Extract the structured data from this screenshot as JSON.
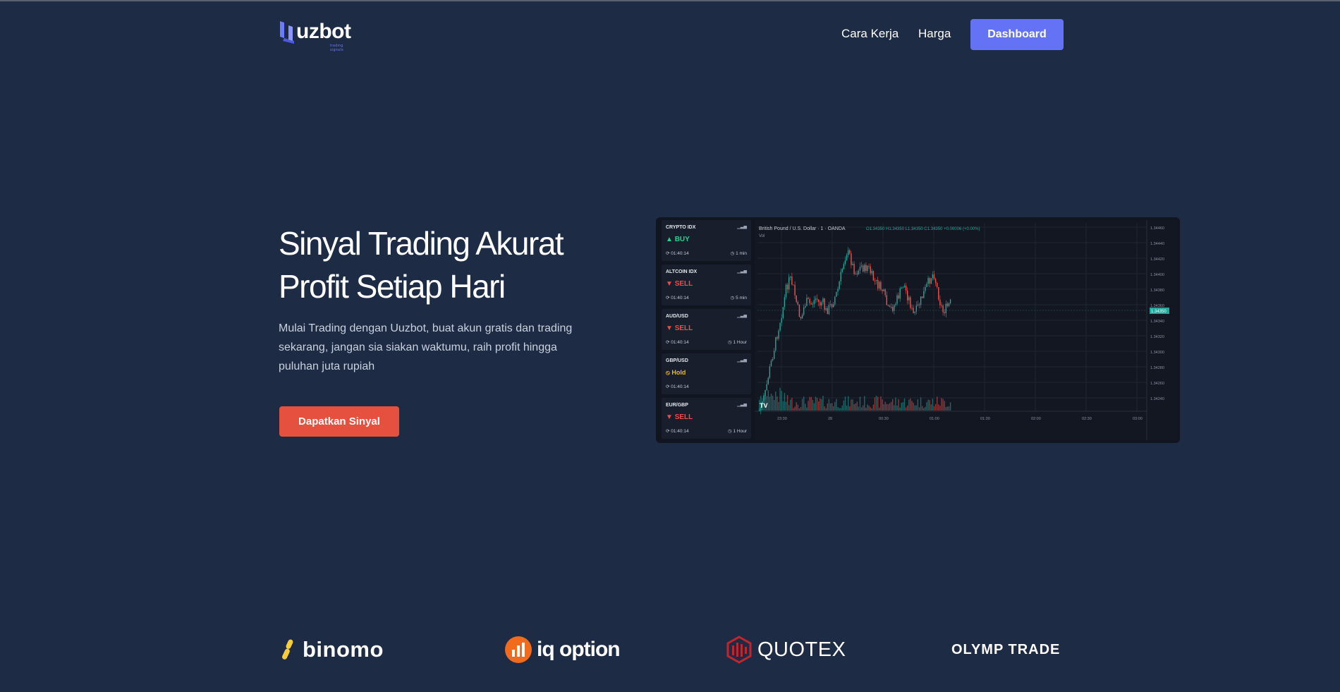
{
  "nav": {
    "logo_text": "uzbot",
    "logo_tagline": "trading signals",
    "links": [
      "Cara Kerja",
      "Harga"
    ],
    "dashboard_label": "Dashboard"
  },
  "hero": {
    "title_line1": "Sinyal Trading Akurat",
    "title_line2": "Profit Setiap Hari",
    "description": "Mulai Trading dengan Uuzbot, buat akun gratis dan trading sekarang, jangan sia siakan waktumu, raih profit hingga puluhan juta rupiah",
    "cta_label": "Dapatkan Sinyal"
  },
  "preview": {
    "signals": [
      {
        "pair": "CRYPTO IDX",
        "action": "BUY",
        "type": "buy",
        "time": "01:40:14",
        "timeframe": "1 min"
      },
      {
        "pair": "ALTCOIN IDX",
        "action": "SELL",
        "type": "sell",
        "time": "01:40:14",
        "timeframe": "5 min"
      },
      {
        "pair": "AUD/USD",
        "action": "SELL",
        "type": "sell",
        "time": "01:40:14",
        "timeframe": "1 Hour"
      },
      {
        "pair": "GBP/USD",
        "action": "Hold",
        "type": "hold",
        "time": "01:40:14",
        "timeframe": ""
      },
      {
        "pair": "EUR/GBP",
        "action": "SELL",
        "type": "sell",
        "time": "01:40:14",
        "timeframe": "1 Hour"
      }
    ],
    "chart_title": "British Pound / U.S. Dollar · 1 · OANDA",
    "chart_ohlc": "O1.34350 H1.34350 L1.34350 C1.34350 +0.00006 (+0.00%)",
    "chart_vol": "Vol",
    "x_ticks": [
      "23:30",
      "28",
      "00:30",
      "01:00",
      "01:30",
      "02:00",
      "02:30",
      "03:00"
    ],
    "y_ticks": [
      "1.34460",
      "1.34440",
      "1.34420",
      "1.34400",
      "1.34380",
      "1.34360",
      "1.34340",
      "1.34320",
      "1.34300",
      "1.34280",
      "1.34260",
      "1.34240"
    ],
    "price_label": "1.34350",
    "colors": {
      "up": "#26a69a",
      "down": "#ef5350"
    }
  },
  "brokers": [
    "binomo",
    "iq option",
    "QUOTEX",
    "OLYMP TRADE"
  ]
}
